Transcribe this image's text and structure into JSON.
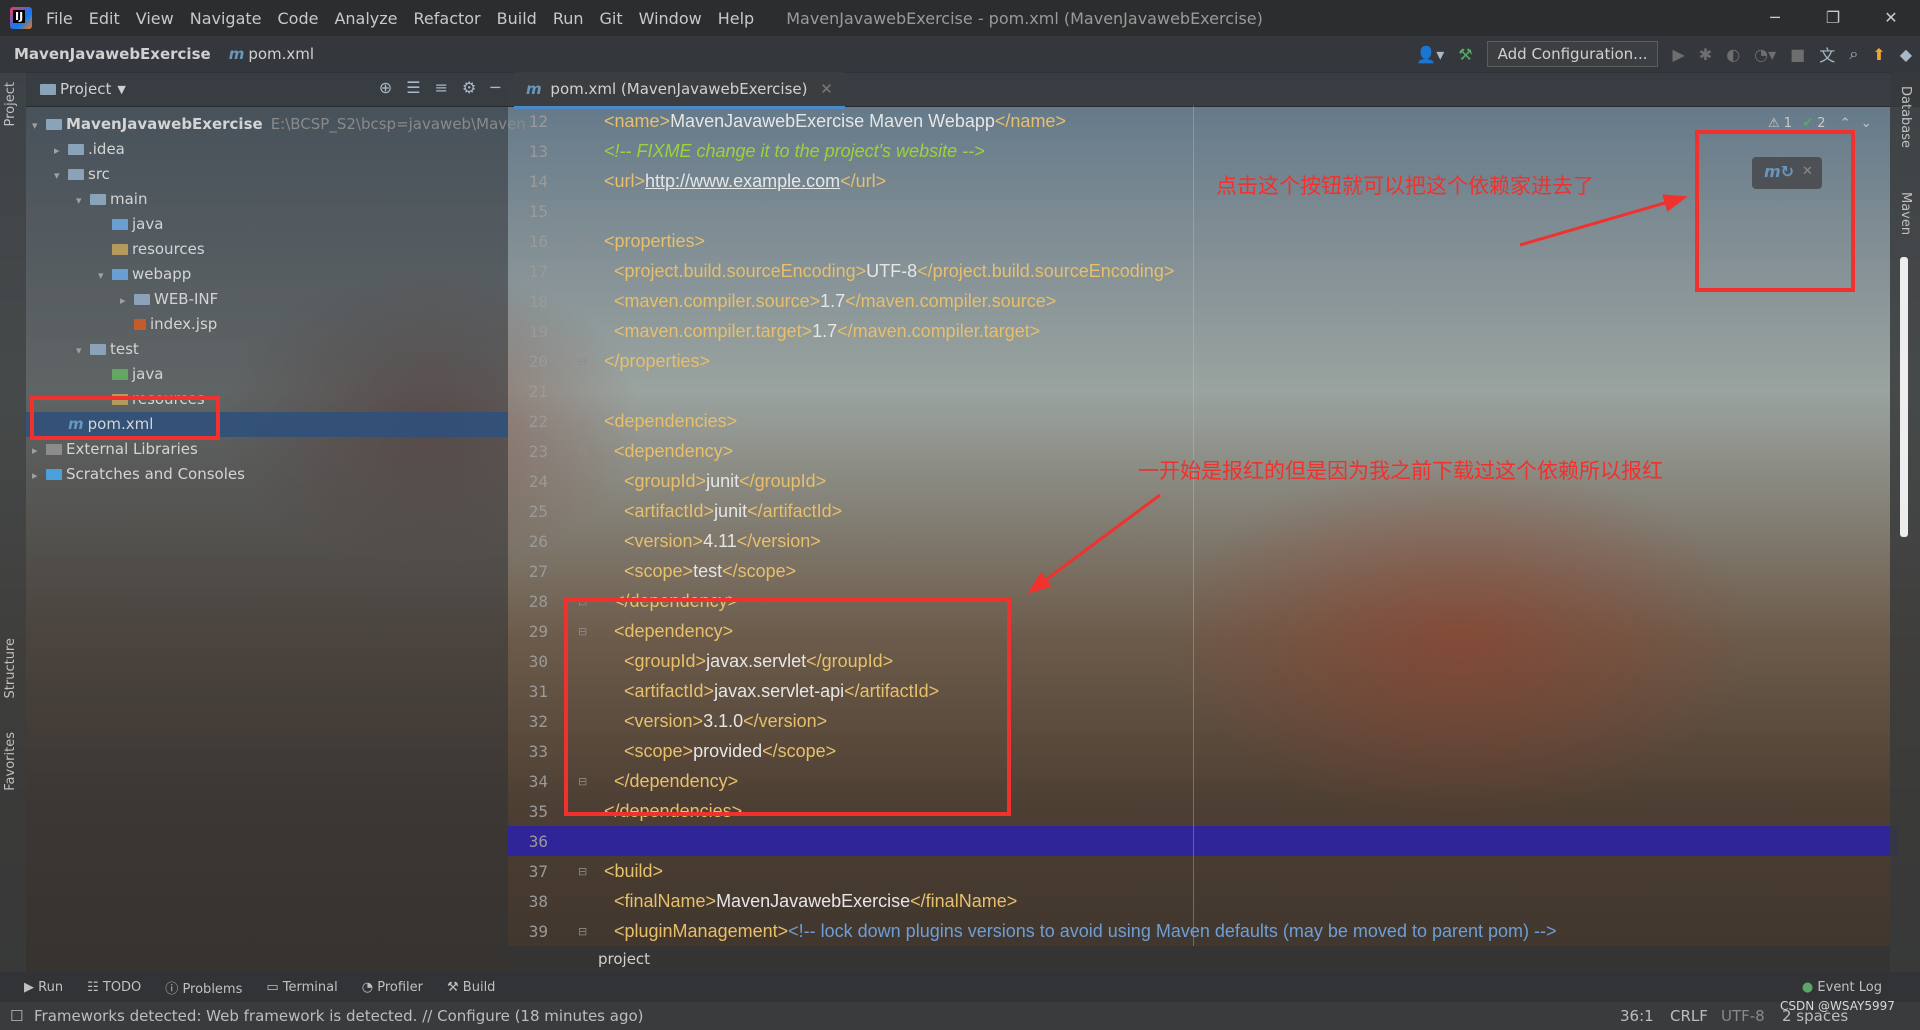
{
  "menubar": {
    "items": [
      "File",
      "Edit",
      "View",
      "Navigate",
      "Code",
      "Analyze",
      "Refactor",
      "Build",
      "Run",
      "Git",
      "Window",
      "Help"
    ],
    "window_title": "MavenJavawebExercise - pom.xml (MavenJavawebExercise)"
  },
  "navbar": {
    "project": "MavenJavawebExercise",
    "file": "pom.xml",
    "add_configuration": "Add Configuration..."
  },
  "left_stripe": {
    "project": "Project",
    "structure": "Structure",
    "favorites": "Favorites"
  },
  "right_stripe": {
    "database": "Database",
    "maven": "Maven"
  },
  "project_panel": {
    "title": "Project",
    "tree": [
      {
        "label": "MavenJavawebExercise",
        "path": "E:\\BCSP_S2\\bcsp=javaweb\\Maven"
      },
      {
        "label": ".idea"
      },
      {
        "label": "src"
      },
      {
        "label": "main"
      },
      {
        "label": "java"
      },
      {
        "label": "resources"
      },
      {
        "label": "webapp"
      },
      {
        "label": "WEB-INF"
      },
      {
        "label": "index.jsp"
      },
      {
        "label": "test"
      },
      {
        "label": "java"
      },
      {
        "label": "resources"
      },
      {
        "label": "pom.xml"
      },
      {
        "label": "External Libraries"
      },
      {
        "label": "Scratches and Consoles"
      }
    ]
  },
  "editor": {
    "tab": "pom.xml (MavenJavawebExercise)",
    "inspections": {
      "warnings": "1",
      "ok": "2"
    },
    "line_numbers": [
      "12",
      "13",
      "14",
      "15",
      "16",
      "17",
      "18",
      "19",
      "20",
      "21",
      "22",
      "23",
      "24",
      "25",
      "26",
      "27",
      "28",
      "29",
      "30",
      "31",
      "32",
      "33",
      "34",
      "35",
      "36",
      "37",
      "38",
      "39"
    ],
    "lines": [
      {
        "indent": 0,
        "parts": [
          [
            "tg",
            "<name>"
          ],
          [
            "tx",
            "MavenJavawebExercise Maven Webapp"
          ],
          [
            "tg",
            "</name>"
          ]
        ]
      },
      {
        "indent": 0,
        "parts": [
          [
            "cm",
            "<!-- FIXME change it to the project's website -->"
          ]
        ]
      },
      {
        "indent": 0,
        "parts": [
          [
            "tg",
            "<url>"
          ],
          [
            "lnk",
            "http://www.example.com"
          ],
          [
            "tg",
            "</url>"
          ]
        ]
      },
      {
        "indent": 0,
        "parts": []
      },
      {
        "indent": 0,
        "parts": [
          [
            "tg",
            "<properties>"
          ]
        ]
      },
      {
        "indent": 1,
        "parts": [
          [
            "tg",
            "<project.build.sourceEncoding>"
          ],
          [
            "tx",
            "UTF-8"
          ],
          [
            "tg",
            "</project.build.sourceEncoding>"
          ]
        ]
      },
      {
        "indent": 1,
        "parts": [
          [
            "tg",
            "<maven.compiler.source>"
          ],
          [
            "tx",
            "1.7"
          ],
          [
            "tg",
            "</maven.compiler.source>"
          ]
        ]
      },
      {
        "indent": 1,
        "parts": [
          [
            "tg",
            "<maven.compiler.target>"
          ],
          [
            "tx",
            "1.7"
          ],
          [
            "tg",
            "</maven.compiler.target>"
          ]
        ]
      },
      {
        "indent": 0,
        "parts": [
          [
            "tg",
            "</properties>"
          ]
        ]
      },
      {
        "indent": 0,
        "parts": []
      },
      {
        "indent": 0,
        "parts": [
          [
            "tg",
            "<dependencies>"
          ]
        ]
      },
      {
        "indent": 1,
        "parts": [
          [
            "tg",
            "<dependency>"
          ]
        ]
      },
      {
        "indent": 2,
        "parts": [
          [
            "tg",
            "<groupId>"
          ],
          [
            "tx",
            "junit"
          ],
          [
            "tg",
            "</groupId>"
          ]
        ]
      },
      {
        "indent": 2,
        "parts": [
          [
            "tg",
            "<artifactId>"
          ],
          [
            "tx",
            "junit"
          ],
          [
            "tg",
            "</artifactId>"
          ]
        ]
      },
      {
        "indent": 2,
        "parts": [
          [
            "tg",
            "<version>"
          ],
          [
            "tx",
            "4.11"
          ],
          [
            "tg",
            "</version>"
          ]
        ]
      },
      {
        "indent": 2,
        "parts": [
          [
            "tg",
            "<scope>"
          ],
          [
            "tx",
            "test"
          ],
          [
            "tg",
            "</scope>"
          ]
        ]
      },
      {
        "indent": 1,
        "parts": [
          [
            "tg",
            "</dependency>"
          ]
        ]
      },
      {
        "indent": 1,
        "parts": [
          [
            "tg",
            "<dependency>"
          ]
        ]
      },
      {
        "indent": 2,
        "parts": [
          [
            "tg",
            "<groupId>"
          ],
          [
            "tx",
            "javax.servlet"
          ],
          [
            "tg",
            "</groupId>"
          ]
        ]
      },
      {
        "indent": 2,
        "parts": [
          [
            "tg",
            "<artifactId>"
          ],
          [
            "tx",
            "javax.servlet-api"
          ],
          [
            "tg",
            "</artifactId>"
          ]
        ]
      },
      {
        "indent": 2,
        "parts": [
          [
            "tg",
            "<version>"
          ],
          [
            "tx",
            "3.1.0"
          ],
          [
            "tg",
            "</version>"
          ]
        ]
      },
      {
        "indent": 2,
        "parts": [
          [
            "tg",
            "<scope>"
          ],
          [
            "tx",
            "provided"
          ],
          [
            "tg",
            "</scope>"
          ]
        ]
      },
      {
        "indent": 1,
        "parts": [
          [
            "tg",
            "</dependency>"
          ]
        ]
      },
      {
        "indent": 0,
        "parts": [
          [
            "tg",
            "</dependencies>"
          ]
        ]
      },
      {
        "indent": 0,
        "parts": []
      },
      {
        "indent": 0,
        "parts": [
          [
            "tg",
            "<build>"
          ]
        ]
      },
      {
        "indent": 1,
        "parts": [
          [
            "tg",
            "<finalName>"
          ],
          [
            "tx",
            "MavenJavawebExercise"
          ],
          [
            "tg",
            "</finalName>"
          ]
        ]
      },
      {
        "indent": 1,
        "parts": [
          [
            "tg",
            "<pluginManagement>"
          ],
          [
            "cm2",
            "<!-- lock down plugins versions to avoid using Maven defaults (may be moved to parent pom) -->"
          ]
        ]
      }
    ],
    "breadcrumb": "project"
  },
  "annotations": {
    "top": "点击这个按钮就可以把这个依赖家进去了",
    "middle": "一开始是报红的但是因为我之前下载过这个依赖所以报红"
  },
  "tool_windows": [
    "Run",
    "TODO",
    "Problems",
    "Terminal",
    "Profiler",
    "Build"
  ],
  "event_log": "Event Log",
  "status": {
    "message": "Frameworks detected: Web framework is detected. // Configure (18 minutes ago)",
    "position": "36:1",
    "line_sep": "CRLF",
    "encoding": "UTF-8",
    "indent": "2 spaces",
    "watermark": "CSDN @WSAY5997"
  },
  "colors": {
    "annotation": "#f0312d",
    "tag": "#e8bf6a",
    "comment": "#9ad33a",
    "current_line": "#2a20aa"
  }
}
